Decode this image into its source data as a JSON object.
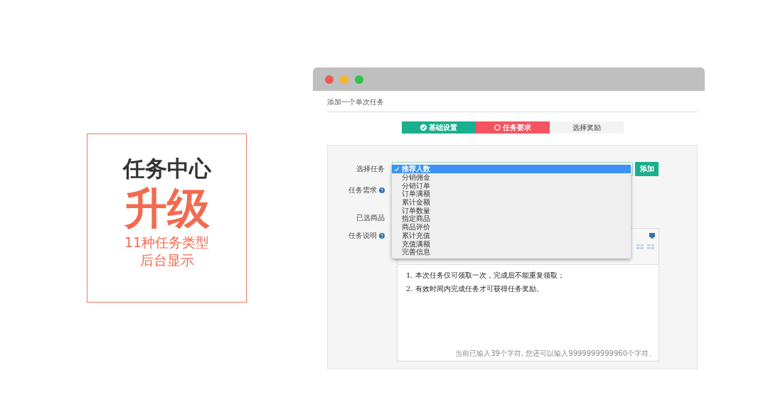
{
  "promo": {
    "title": "任务中心",
    "headline": "升级",
    "lines": [
      "11种任务类型",
      "后台显示"
    ]
  },
  "window": {
    "title": "添加一个单次任务"
  },
  "steps": [
    {
      "label": "基础设置",
      "completed": true,
      "selected": false
    },
    {
      "label": "任务要求",
      "completed": false,
      "selected": true
    },
    {
      "label": "选择奖励",
      "completed": false,
      "selected": false
    }
  ],
  "form": {
    "labels": [
      {
        "text": "选择任务",
        "help": false
      },
      {
        "text": "任务需求",
        "help": true
      },
      {
        "text": "已选商品",
        "help": false
      },
      {
        "text": "任务说明",
        "help": true
      }
    ],
    "add_button": "添加",
    "dropdown": [
      {
        "label": "推荐人数",
        "selected": true
      },
      {
        "label": "分销佣金",
        "selected": false
      },
      {
        "label": "分销订单",
        "selected": false
      },
      {
        "label": "订单满额",
        "selected": false
      },
      {
        "label": "累计金额",
        "selected": false
      },
      {
        "label": "订单数量",
        "selected": false
      },
      {
        "label": "指定商品",
        "selected": false
      },
      {
        "label": "商品评价",
        "selected": false
      },
      {
        "label": "累计充值",
        "selected": false
      },
      {
        "label": "充值满额",
        "selected": false
      },
      {
        "label": "完善信息",
        "selected": false
      }
    ],
    "editor": {
      "lines": [
        "1. 本次任务仅可领取一次，完成后不能重复领取；",
        "2. 有效时间内完成任务才可获得任务奖励。"
      ],
      "counter": "当前已输入39个字符, 您还可以输入9999999999960个字符。"
    }
  }
}
